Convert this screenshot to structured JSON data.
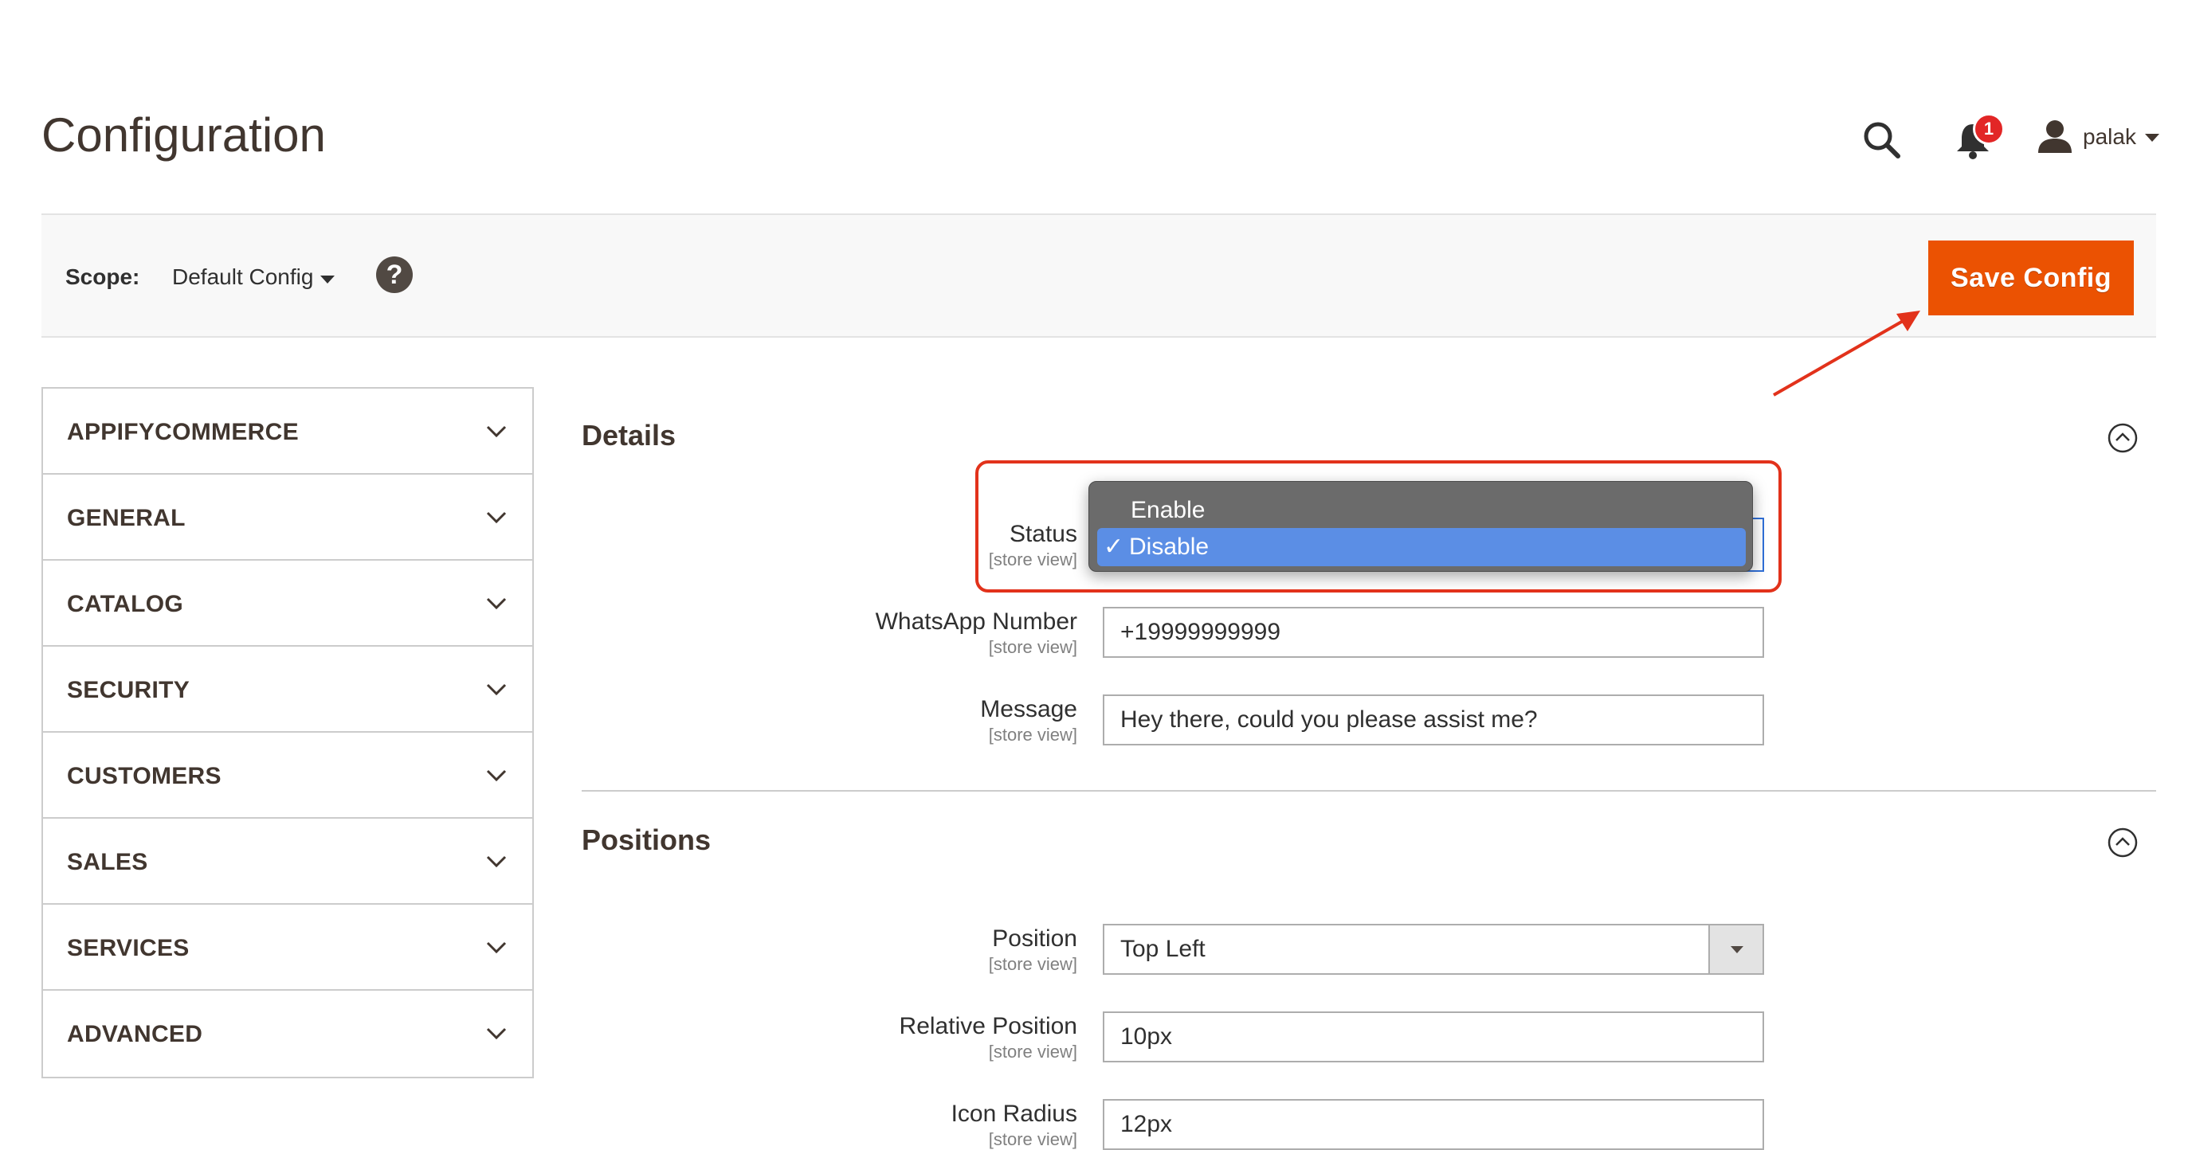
{
  "page": {
    "title": "Configuration"
  },
  "header": {
    "user": "palak",
    "notifications_count": "1"
  },
  "scope": {
    "label": "Scope:",
    "value": "Default Config",
    "help": "?"
  },
  "toolbar": {
    "save_label": "Save Config"
  },
  "sidebar": {
    "items": [
      {
        "label": "APPIFYCOMMERCE"
      },
      {
        "label": "GENERAL"
      },
      {
        "label": "CATALOG"
      },
      {
        "label": "SECURITY"
      },
      {
        "label": "CUSTOMERS"
      },
      {
        "label": "SALES"
      },
      {
        "label": "SERVICES"
      },
      {
        "label": "ADVANCED"
      }
    ]
  },
  "details": {
    "title": "Details",
    "status": {
      "label": "Status",
      "scope": "[store view]",
      "options": [
        "Enable",
        "Disable"
      ],
      "selected": "Disable",
      "check": "✓"
    },
    "whatsapp": {
      "label": "WhatsApp Number",
      "scope": "[store view]",
      "value": "+19999999999"
    },
    "message": {
      "label": "Message",
      "scope": "[store view]",
      "value": "Hey there, could you please assist me?"
    }
  },
  "positions": {
    "title": "Positions",
    "position": {
      "label": "Position",
      "scope": "[store view]",
      "value": "Top Left"
    },
    "relative": {
      "label": "Relative Position",
      "scope": "[store view]",
      "value": "10px"
    },
    "radius": {
      "label": "Icon Radius",
      "scope": "[store view]",
      "value": "12px"
    }
  },
  "colors": {
    "accent": "#eb5202",
    "highlight": "#e2321b",
    "selected_option": "#5b8ee5",
    "badge": "#e22626"
  }
}
